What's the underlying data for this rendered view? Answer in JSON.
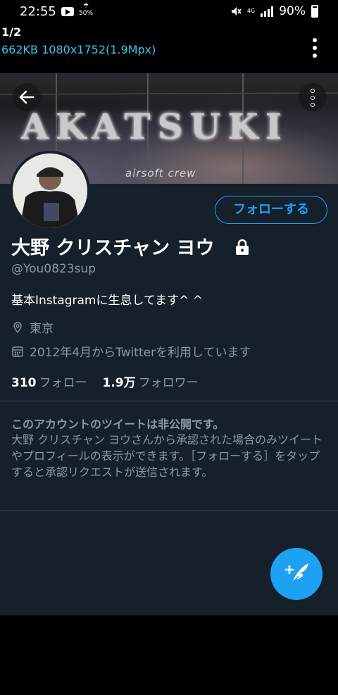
{
  "status_bar": {
    "time": "22:55",
    "rain_percent": "50%",
    "network": "4G",
    "battery": "90%"
  },
  "viewer": {
    "counter": "1/2",
    "file_info": "662KB 1080x1752(1.9Mpx)"
  },
  "profile": {
    "banner_title": "AKATSUKI",
    "banner_subtitle": "airsoft crew",
    "follow_button": "フォローする",
    "display_name": "大野 クリスチャン ヨウ",
    "handle": "@You0823sup",
    "bio": "基本Instagramに生息してます^ ^",
    "location": "東京",
    "joined": "2012年4月からTwitterを利用しています",
    "following_count": "310",
    "following_label": "フォロー",
    "followers_count": "1.9万",
    "followers_label": "フォロワー",
    "protected_title": "このアカウントのツイートは非公開です。",
    "protected_body": "大野 クリスチャン ヨウさんから承認された場合のみツイートやプロフィールの表示ができます。［フォローする］をタップすると承認リクエストが送信されます。"
  },
  "colors": {
    "accent": "#1da1f2",
    "background": "#15202b",
    "secondary_text": "#8899a6",
    "viewer_info": "#3ec4f2"
  }
}
